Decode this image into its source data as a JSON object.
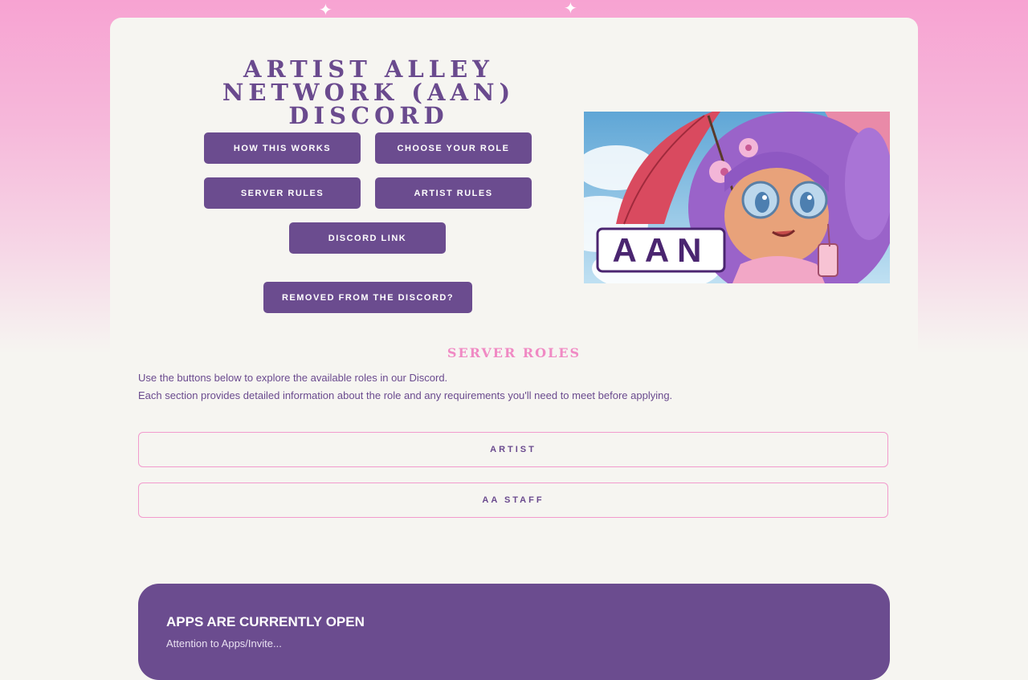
{
  "header": {
    "title": "ARTIST ALLEY NETWORK (AAN) DISCORD"
  },
  "nav_buttons": {
    "how_this_works": "HOW THIS WORKS",
    "choose_your_role": "CHOOSE YOUR ROLE",
    "server_rules": "SERVER RULES",
    "artist_rules": "ARTIST RULES",
    "discord_link": "DISCORD LINK",
    "removed": "REMOVED FROM THE DISCORD?"
  },
  "hero": {
    "logo_text": "AAN"
  },
  "server_roles": {
    "title": "SERVER ROLES",
    "line1": "Use the buttons below to explore the available roles in our Discord.",
    "line2": "Each section provides detailed information about the role and any requirements you'll need to meet before applying.",
    "roles": [
      "ARTIST",
      "AA STAFF"
    ]
  },
  "apps": {
    "title": "APPS ARE CURRENTLY OPEN",
    "subtitle": "Attention to Apps/Invite..."
  },
  "colors": {
    "accent_purple": "#6b4c8f",
    "accent_pink": "#f29bcd",
    "background": "#f6f5f1"
  }
}
